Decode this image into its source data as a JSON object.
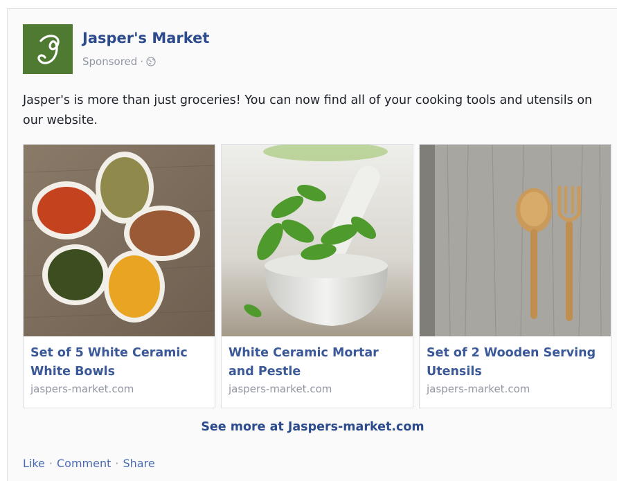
{
  "post": {
    "page_name": "Jasper's Market",
    "logo_letter": "J",
    "sponsored_label": "Sponsored",
    "meta_separator": "·",
    "globe_icon": "globe-icon",
    "body": "Jasper's is more than just groceries! You can now find all of your cooking tools and utensils on our website."
  },
  "carousel": [
    {
      "title": "Set of 5 White Ceramic White Bowls",
      "domain": "jaspers-market.com",
      "image": "spice-bowls-photo"
    },
    {
      "title": "White Ceramic Mortar and Pestle",
      "domain": "jaspers-market.com",
      "image": "mortar-pestle-photo"
    },
    {
      "title": "Set of 2 Wooden Serving Utensils",
      "domain": "jaspers-market.com",
      "image": "wooden-utensils-photo"
    }
  ],
  "see_more": "See more at Jaspers-market.com",
  "actions": {
    "like": "Like",
    "comment": "Comment",
    "share": "Share",
    "separator": "·"
  },
  "colors": {
    "link_blue": "#3b5998",
    "logo_green": "#4e7a31",
    "muted_gray": "#9197a3"
  }
}
